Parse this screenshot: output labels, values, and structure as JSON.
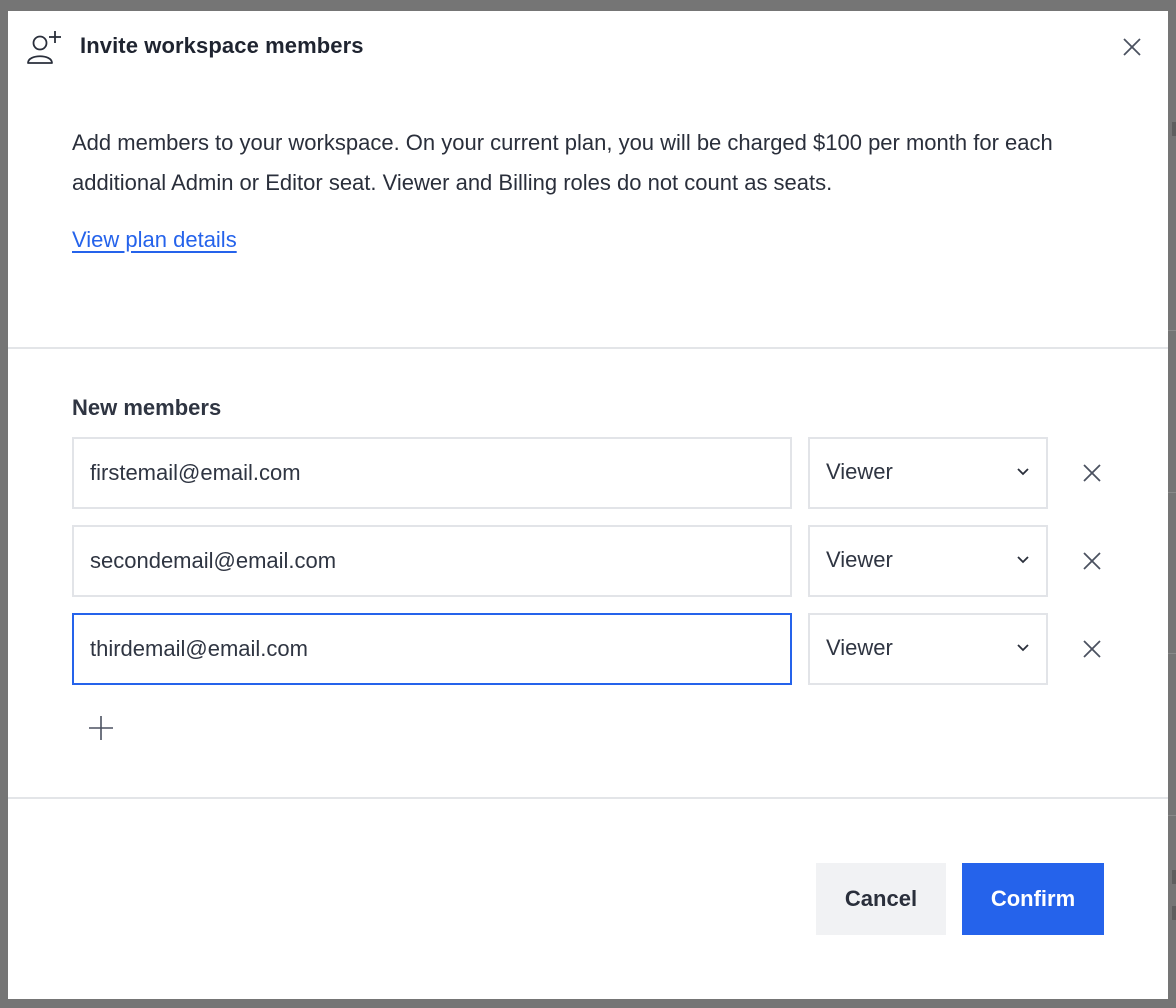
{
  "dialog": {
    "title": "Invite workspace members",
    "title_icon": "add-person-icon",
    "close_icon": "close-icon",
    "description": "Add members to your workspace. On your current plan, you will be charged $100 per month for each additional Admin or Editor seat. Viewer and Billing roles do not count as seats.",
    "plan_link": "View plan details"
  },
  "members": {
    "label": "New members",
    "rows": [
      {
        "email": "firstemail@email.com",
        "role": "Viewer",
        "focused": false
      },
      {
        "email": "secondemail@email.com",
        "role": "Viewer",
        "focused": false
      },
      {
        "email": "thirdemail@email.com",
        "role": "Viewer",
        "focused": true
      }
    ],
    "add_icon": "plus-icon",
    "remove_icon": "close-icon",
    "dropdown_icon": "chevron-down-icon"
  },
  "footer": {
    "cancel_label": "Cancel",
    "confirm_label": "Confirm"
  },
  "colors": {
    "accent": "#2563eb",
    "backdrop": "#757575",
    "secondary_button": "#f1f2f4",
    "border": "#e2e4e8"
  }
}
